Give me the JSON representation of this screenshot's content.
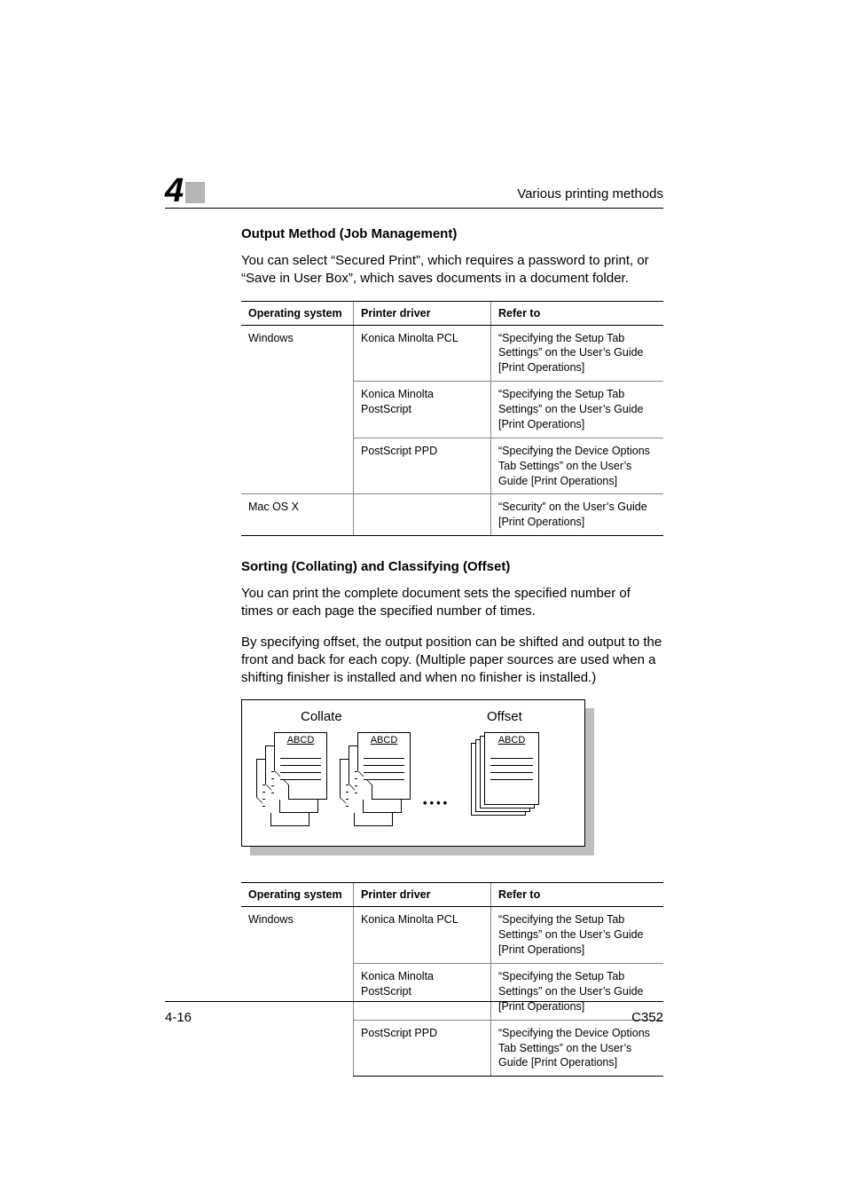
{
  "header": {
    "chapter_number": "4",
    "running_head": "Various printing methods"
  },
  "section1": {
    "heading": "Output Method (Job Management)",
    "para": "You can select “Secured Print”, which requires a password to print, or “Save in User Box”, which saves documents in a document folder."
  },
  "table_headers": {
    "os": "Operating system",
    "driver": "Printer driver",
    "refer": "Refer to"
  },
  "table1_rows": [
    {
      "os": "Windows",
      "driver": "Konica Minolta PCL",
      "refer": "“Specifying the Setup Tab Settings” on the User’s Guide [Print Operations]"
    },
    {
      "os": "",
      "driver": "Konica Minolta PostScript",
      "refer": "“Specifying the Setup Tab Settings” on the User’s Guide [Print Operations]"
    },
    {
      "os": "",
      "driver": "PostScript PPD",
      "refer": "“Specifying the Device Options Tab Settings” on the User’s Guide [Print Operations]"
    },
    {
      "os": "Mac OS X",
      "driver": "",
      "refer": "“Security” on the User’s Guide [Print Operations]"
    }
  ],
  "section2": {
    "heading": "Sorting (Collating) and Classifying (Offset)",
    "para1": "You can print the complete document sets the specified number of times or each page the specified number of times.",
    "para2": "By specifying offset, the output position can be shifted and output to the front and back for each copy. (Multiple paper sources are used when a shifting finisher is installed and when no finisher is installed.)"
  },
  "diagram": {
    "label_left": "Collate",
    "label_right": "Offset",
    "page_label": "ABCD"
  },
  "table2_rows": [
    {
      "os": "Windows",
      "driver": "Konica Minolta PCL",
      "refer": "“Specifying the Setup Tab Settings” on the User’s Guide [Print Operations]"
    },
    {
      "os": "",
      "driver": "Konica Minolta PostScript",
      "refer": "“Specifying the Setup Tab Settings” on the User’s Guide [Print Operations]"
    },
    {
      "os": "",
      "driver": "PostScript PPD",
      "refer": "“Specifying the Device Options Tab Settings” on the User’s Guide [Print Operations]"
    }
  ],
  "footer": {
    "left": "4-16",
    "right": "C352"
  }
}
